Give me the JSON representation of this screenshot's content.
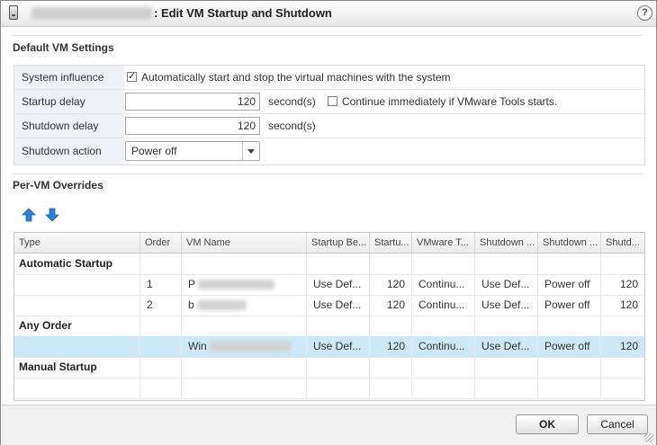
{
  "dialog": {
    "title": ": Edit VM Startup and Shutdown",
    "help_label": "?"
  },
  "default_settings": {
    "heading": "Default VM Settings",
    "system_influence": {
      "label": "System influence",
      "checked": true,
      "text": "Automatically start and stop the virtual machines with the system"
    },
    "startup_delay": {
      "label": "Startup delay",
      "value": "120",
      "unit": "second(s)",
      "checkbox_checked": false,
      "checkbox_text": "Continue immediately if VMware Tools starts."
    },
    "shutdown_delay": {
      "label": "Shutdown delay",
      "value": "120",
      "unit": "second(s)"
    },
    "shutdown_action": {
      "label": "Shutdown action",
      "value": "Power off"
    }
  },
  "overrides": {
    "heading": "Per-VM Overrides",
    "toolbar": [
      "move-up-icon",
      "move-down-icon"
    ],
    "columns": [
      "Type",
      "Order",
      "VM Name",
      "Startup Be...",
      "Startu...",
      "VMware T...",
      "Shutdown ...",
      "Shutdown ...",
      "Shutd..."
    ],
    "groups": {
      "automatic": "Automatic Startup",
      "any": "Any Order",
      "manual": "Manual Startup"
    },
    "rows": [
      {
        "order": "1",
        "name": "P",
        "startup_behavior": "Use Def...",
        "startup_delay": "120",
        "vmware_tools": "Continu...",
        "shutdown_behavior": "Use Def...",
        "shutdown_action": "Power off",
        "shutdown_delay": "120"
      },
      {
        "order": "2",
        "name": "b",
        "startup_behavior": "Use Def...",
        "startup_delay": "120",
        "vmware_tools": "Continu...",
        "shutdown_behavior": "Use Def...",
        "shutdown_action": "Power off",
        "shutdown_delay": "120"
      },
      {
        "order": "",
        "name": "Win",
        "startup_behavior": "Use Def...",
        "startup_delay": "120",
        "vmware_tools": "Continu...",
        "shutdown_behavior": "Use Def...",
        "shutdown_action": "Power off",
        "shutdown_delay": "120"
      }
    ]
  },
  "footer": {
    "ok_label": "OK",
    "cancel_label": "Cancel"
  },
  "colors": {
    "selection": "#cde8f6",
    "label_bg": "#eef2f7",
    "arrow_blue": "#2d7fd3"
  }
}
